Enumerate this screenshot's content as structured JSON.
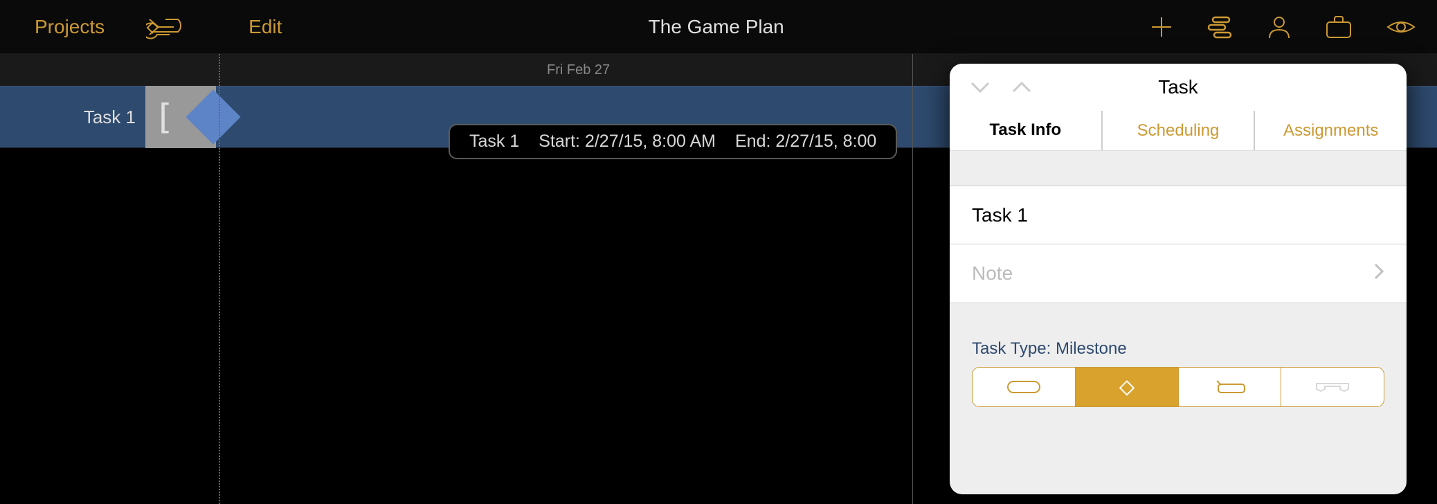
{
  "toolbar": {
    "projects": "Projects",
    "edit": "Edit",
    "title": "The Game Plan"
  },
  "timeline": {
    "date": "Fri Feb 27",
    "task_label": "Task 1",
    "tooltip": {
      "name": "Task 1",
      "start": "Start: 2/27/15, 8:00 AM",
      "end": "End: 2/27/15, 8:00"
    }
  },
  "popover": {
    "title": "Task",
    "tabs": {
      "info": "Task Info",
      "scheduling": "Scheduling",
      "assignments": "Assignments"
    },
    "task_name": "Task 1",
    "note_placeholder": "Note",
    "task_type_label": "Task Type: Milestone"
  }
}
